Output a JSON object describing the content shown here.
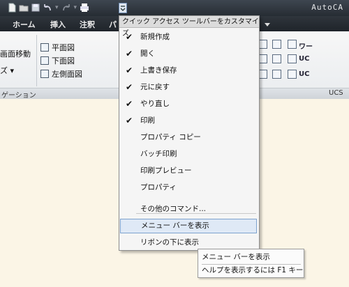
{
  "app": {
    "title": "AutoCA"
  },
  "ribbon": {
    "tabs": [
      "ホーム",
      "挿入",
      "注釈",
      "パ"
    ],
    "left_labels": {
      "pan": "画面移動",
      "sub": "ズ ▾"
    },
    "views": [
      "平面図",
      "下面図",
      "左側面図"
    ],
    "footer_left": "ゲーション",
    "footer_right": "UCS",
    "ucs_items": [
      "ワー",
      "UC",
      "UC"
    ]
  },
  "menu": {
    "header": "クイック アクセス ツールバーをカスタマイズ",
    "items": [
      {
        "label": "新規作成",
        "checked": true
      },
      {
        "label": "開く",
        "checked": true
      },
      {
        "label": "上書き保存",
        "checked": true
      },
      {
        "label": "元に戻す",
        "checked": true
      },
      {
        "label": "やり直し",
        "checked": true
      },
      {
        "label": "印刷",
        "checked": true
      },
      {
        "label": "プロパティ コピー",
        "checked": false
      },
      {
        "label": "バッチ印刷",
        "checked": false
      },
      {
        "label": "印刷プレビュー",
        "checked": false
      },
      {
        "label": "プロパティ",
        "checked": false
      }
    ],
    "more_commands": "その他のコマンド...",
    "show_menubar": "メニュー バーを表示",
    "below_ribbon": "リボンの下に表示",
    "check_glyph": "✔"
  },
  "tooltip": {
    "title": "メニュー バーを表示",
    "help": "ヘルプを表示するには F1 キー"
  }
}
